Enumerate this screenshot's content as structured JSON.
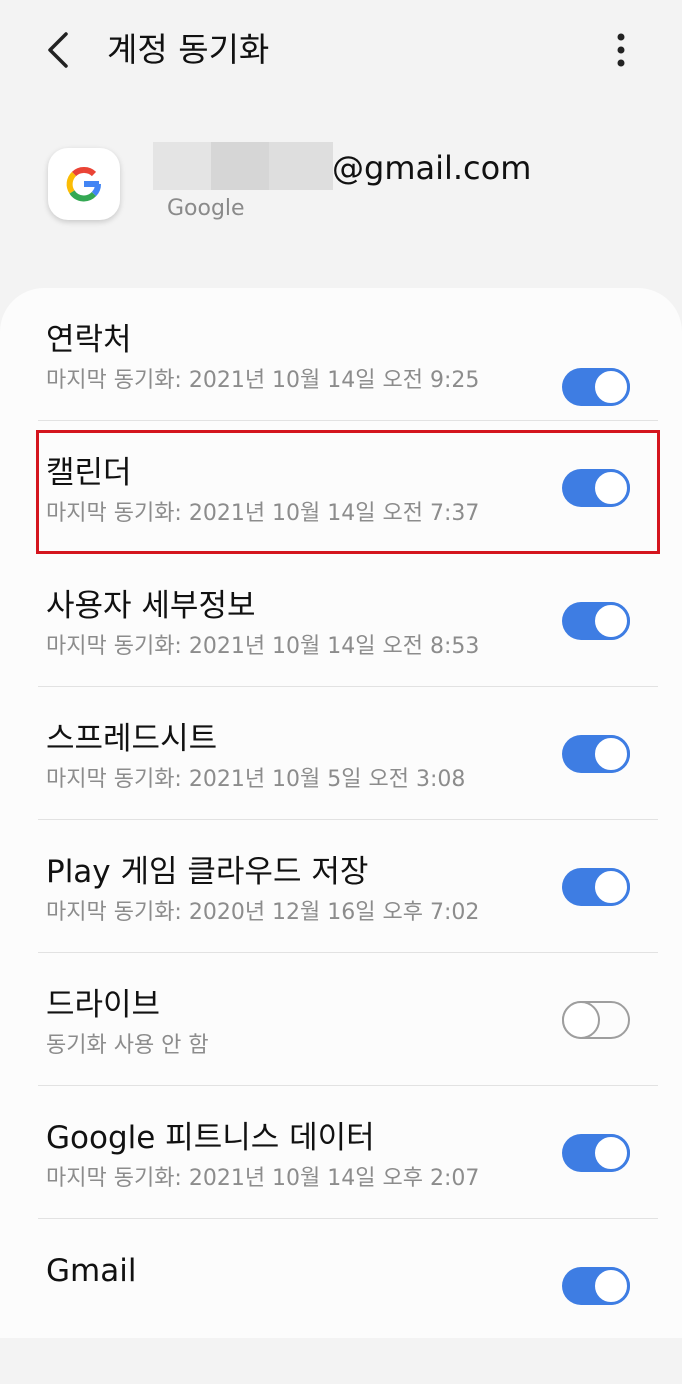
{
  "header": {
    "title": "계정 동기화",
    "back_icon": "chevron-left-icon",
    "more_icon": "more-vertical-icon"
  },
  "account": {
    "email_suffix": "@gmail.com",
    "type": "Google",
    "icon": "google-logo-icon"
  },
  "sync_items": [
    {
      "title": "연락처",
      "subtitle": "마지막 동기화: 2021년 10월 14일 오전 9:25",
      "enabled": true
    },
    {
      "title": "캘린더",
      "subtitle": "마지막 동기화: 2021년 10월 14일 오전 7:37",
      "enabled": true
    },
    {
      "title": "사용자 세부정보",
      "subtitle": "마지막 동기화: 2021년 10월 14일 오전 8:53",
      "enabled": true
    },
    {
      "title": "스프레드시트",
      "subtitle": "마지막 동기화: 2021년 10월 5일 오전 3:08",
      "enabled": true
    },
    {
      "title": "Play 게임 클라우드 저장",
      "subtitle": "마지막 동기화: 2020년 12월 16일 오후 7:02",
      "enabled": true
    },
    {
      "title": "드라이브",
      "subtitle": "동기화 사용 안 함",
      "enabled": false
    },
    {
      "title": "Google 피트니스 데이터",
      "subtitle": "마지막 동기화: 2021년 10월 14일 오후 2:07",
      "enabled": true
    },
    {
      "title": "Gmail",
      "subtitle": "",
      "enabled": true
    }
  ],
  "colors": {
    "toggle_on": "#3e7de3",
    "highlight": "#d4151e"
  }
}
